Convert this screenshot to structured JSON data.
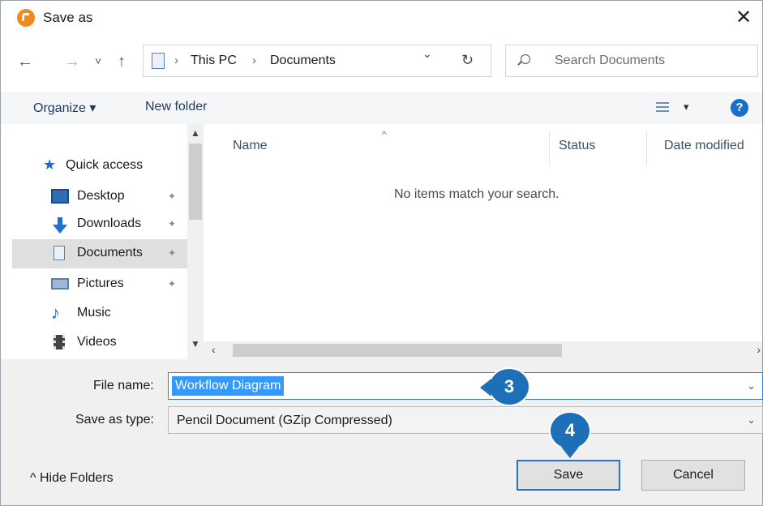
{
  "window": {
    "title": "Save as",
    "close_glyph": "✕"
  },
  "nav": {
    "back_glyph": "←",
    "forward_glyph": "→",
    "recent_glyph": "˅",
    "up_glyph": "↑",
    "breadcrumb": [
      "This PC",
      "Documents"
    ],
    "breadcrumb_sep": "›",
    "dropdown_glyph": "⌄",
    "refresh_glyph": "↻"
  },
  "search": {
    "placeholder": "Search Documents"
  },
  "toolbar": {
    "organize_label": "Organize ▾",
    "new_folder_label": "New folder",
    "view_caret": "▾",
    "help_glyph": "?"
  },
  "sidebar": {
    "quick_access_label": "Quick access",
    "items": [
      {
        "label": "Desktop",
        "icon": "desktop-icon",
        "pinned": true
      },
      {
        "label": "Downloads",
        "icon": "downloads-icon",
        "pinned": true
      },
      {
        "label": "Documents",
        "icon": "documents-icon",
        "pinned": true,
        "selected": true
      },
      {
        "label": "Pictures",
        "icon": "pictures-icon",
        "pinned": true
      },
      {
        "label": "Music",
        "icon": "music-icon",
        "pinned": false
      },
      {
        "label": "Videos",
        "icon": "videos-icon",
        "pinned": false
      }
    ],
    "pin_glyph": "✦"
  },
  "filelist": {
    "columns": [
      "Name",
      "Status",
      "Date modified"
    ],
    "empty_message": "No items match your search."
  },
  "form": {
    "file_name_label": "File name:",
    "file_name_value": "Workflow Diagram",
    "save_type_label": "Save as type:",
    "save_type_value": "Pencil Document (GZip Compressed)",
    "dropdown_glyph": "⌄"
  },
  "footer": {
    "hide_folders_label": "^  Hide Folders",
    "save_label": "Save",
    "cancel_label": "Cancel"
  },
  "callouts": {
    "step3": "3",
    "step4": "4"
  },
  "colors": {
    "accent": "#1d6fb8",
    "selection": "#3399ff",
    "app_icon": "#ef8a1e"
  }
}
